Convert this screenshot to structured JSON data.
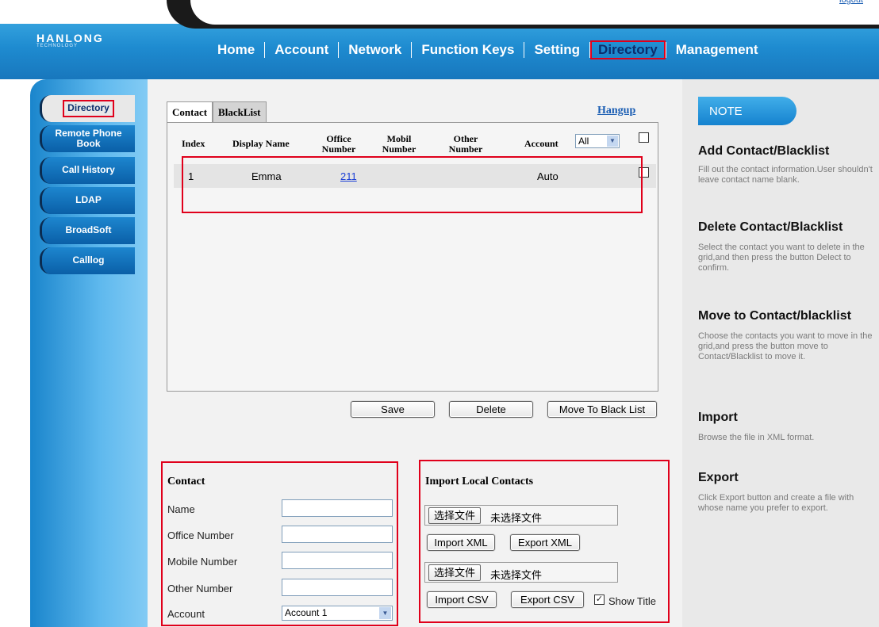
{
  "header": {
    "logout": "logout",
    "logo": "HANLONG",
    "logo_sub": "TECHNOLOGY",
    "nav": [
      "Home",
      "Account",
      "Network",
      "Function Keys",
      "Setting",
      "Directory",
      "Management"
    ],
    "active_nav": "Directory"
  },
  "sidebar": {
    "items": [
      "Directory",
      "Remote Phone Book",
      "Call History",
      "LDAP",
      "BroadSoft",
      "Calllog"
    ],
    "active": "Directory"
  },
  "main": {
    "tabs": [
      "Contact",
      "BlackList"
    ],
    "active_tab": "Contact",
    "hangup": "Hangup",
    "grid": {
      "columns": [
        "Index",
        "Display Name",
        "Office Number",
        "Mobil Number",
        "Other Number",
        "Account"
      ],
      "account_filter": "All",
      "rows": [
        {
          "index": "1",
          "display_name": "Emma",
          "office_number": "211",
          "mobil_number": "",
          "other_number": "",
          "account": "Auto"
        }
      ]
    },
    "buttons": {
      "save": "Save",
      "delete": "Delete",
      "move": "Move To Black List"
    },
    "contact_form": {
      "title": "Contact",
      "name_label": "Name",
      "office_label": "Office Number",
      "mobile_label": "Mobile Number",
      "other_label": "Other Number",
      "account_label": "Account",
      "account_value": "Account 1"
    },
    "import": {
      "title": "Import Local Contacts",
      "choose_file": "选择文件",
      "no_file": "未选择文件",
      "import_xml": "Import XML",
      "export_xml": "Export XML",
      "import_csv": "Import CSV",
      "export_csv": "Export CSV",
      "show_title": "Show Title",
      "show_title_checked": true
    }
  },
  "note": {
    "tab": "NOTE",
    "sections": [
      {
        "heading": "Add Contact/Blacklist",
        "text": "Fill out the contact information.User shouldn't leave contact name blank."
      },
      {
        "heading": "Delete Contact/Blacklist",
        "text": "Select the contact you want to delete in the grid,and then press the button Delect to confirm."
      },
      {
        "heading": "Move to Contact/blacklist",
        "text": "Choose the contacts you want to move in the grid,and press the button move to Contact/Blacklist to move it."
      },
      {
        "heading": "Import",
        "text": "Browse the file in XML format."
      },
      {
        "heading": "Export",
        "text": "Click Export button and create a file with whose name you prefer to export."
      }
    ]
  },
  "colors": {
    "header_blue": "#1e8bd0",
    "highlight_red": "#e0001b",
    "link_blue": "#1a5db3"
  }
}
